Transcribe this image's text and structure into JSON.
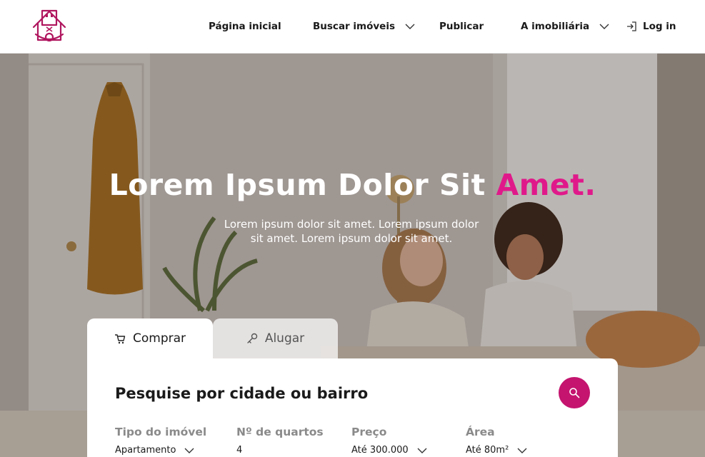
{
  "header": {
    "logo_icon": "house-logo-icon",
    "nav": {
      "home": "Página inicial",
      "buscar": "Buscar imóveis",
      "publicar": "Publicar",
      "imobiliaria": "A imobiliária",
      "login": "Log in"
    }
  },
  "hero": {
    "title_main": "Lorem Ipsum Dolor Sit ",
    "title_accent": "Amet.",
    "subtitle": "Lorem ipsum dolor sit amet. Lorem ipsum dolor sit amet. Lorem ipsum dolor sit amet."
  },
  "search": {
    "tabs": [
      {
        "label": "Comprar",
        "icon": "cart-icon",
        "active": true
      },
      {
        "label": "Alugar",
        "icon": "key-icon",
        "active": false
      }
    ],
    "title": "Pesquise por cidade ou bairro",
    "filters": [
      {
        "label": "Tipo do imóvel",
        "value": "Apartamento"
      },
      {
        "label": "Nº de quartos",
        "value": "4"
      },
      {
        "label": "Preço",
        "value": "Até 300.000"
      },
      {
        "label": "Área",
        "value": "Até 80m²"
      }
    ]
  },
  "colors": {
    "accent": "#e0198a",
    "button": "#c4146f",
    "logo": "#b0175f"
  }
}
